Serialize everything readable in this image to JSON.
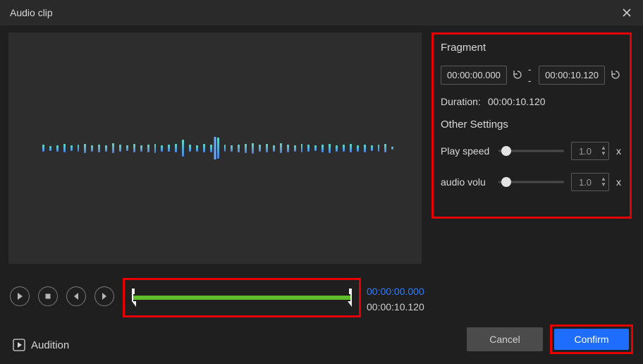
{
  "titlebar": {
    "title": "Audio clip"
  },
  "fragment": {
    "heading": "Fragment",
    "start": "00:00:00.000",
    "end": "00:00:10.120",
    "separator": "--",
    "duration_label": "Duration:",
    "duration_value": "00:00:10.120"
  },
  "other_settings": {
    "heading": "Other Settings",
    "play_speed": {
      "label": "Play speed",
      "value": "1.0",
      "suffix": "x"
    },
    "audio_volume": {
      "label": "audio volu",
      "value": "1.0",
      "suffix": "x"
    }
  },
  "timeline": {
    "current": "00:00:00.000",
    "total": "00:00:10.120"
  },
  "audition": {
    "label": "Audition"
  },
  "buttons": {
    "cancel": "Cancel",
    "confirm": "Confirm"
  }
}
